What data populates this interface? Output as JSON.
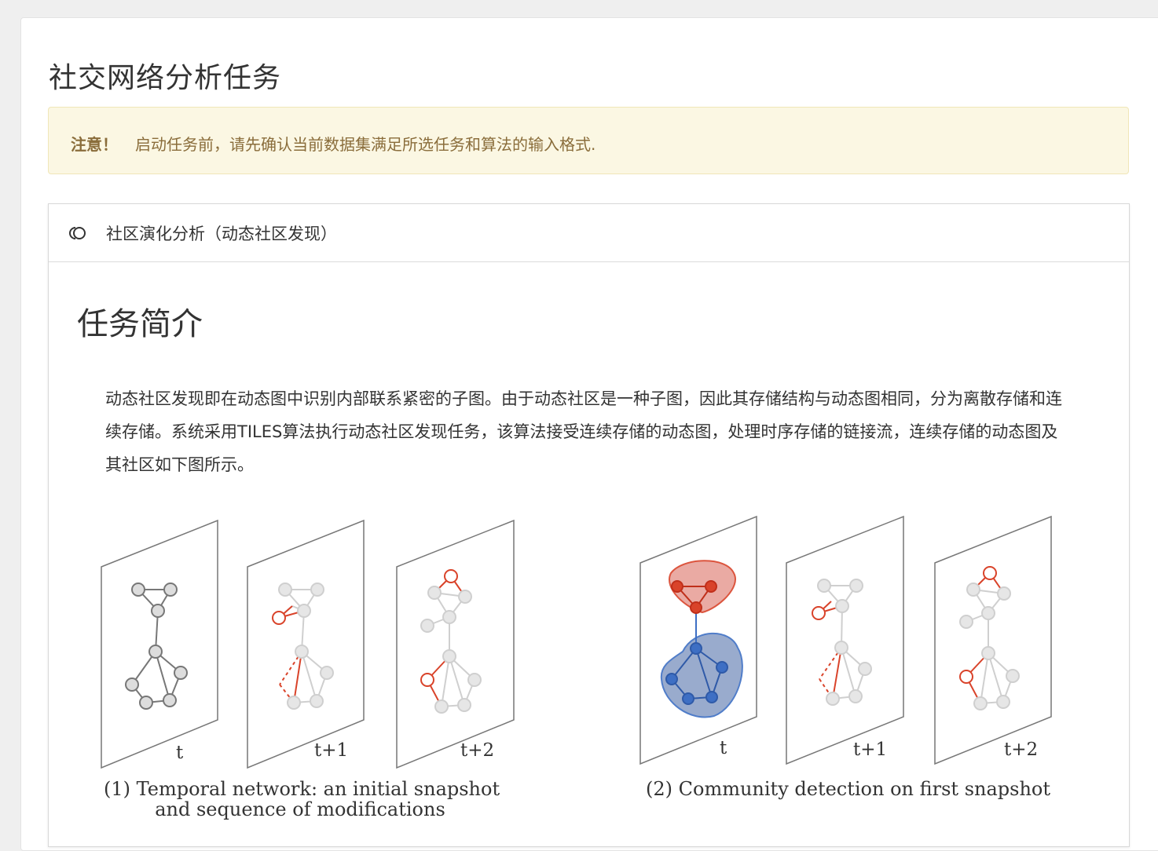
{
  "page": {
    "title": "社交网络分析任务"
  },
  "alert": {
    "strong": "注意！",
    "text": "启动任务前，请先确认当前数据集满足所选任务和算法的输入格式."
  },
  "panel": {
    "icon": "community-rings-icon",
    "title": "社区演化分析（动态社区发现）",
    "section_title": "任务简介",
    "intro": "动态社区发现即在动态图中识别内部联系紧密的子图。由于动态社区是一种子图，因此其存储结构与动态图相同，分为离散存储和连续存储。系统采用TILES算法执行动态社区发现任务，该算法接受连续存储的动态图，处理时序存储的链接流，连续存储的动态图及其社区如下图所示。"
  },
  "figure": {
    "left": {
      "labels": [
        "t",
        "t+1",
        "t+2"
      ],
      "caption_line1": "(1) Temporal network: an initial snapshot",
      "caption_line2": "and sequence of modifications"
    },
    "right": {
      "labels": [
        "t",
        "t+1",
        "t+2"
      ],
      "caption_line1": "(2) Community detection on first snapshot"
    },
    "colors": {
      "highlight": "#d9432a",
      "community_red": "#e8a19a",
      "community_blue": "#8ea3c8",
      "node_blue": "#3e6fc4",
      "gray": "#bdbdbd"
    }
  }
}
